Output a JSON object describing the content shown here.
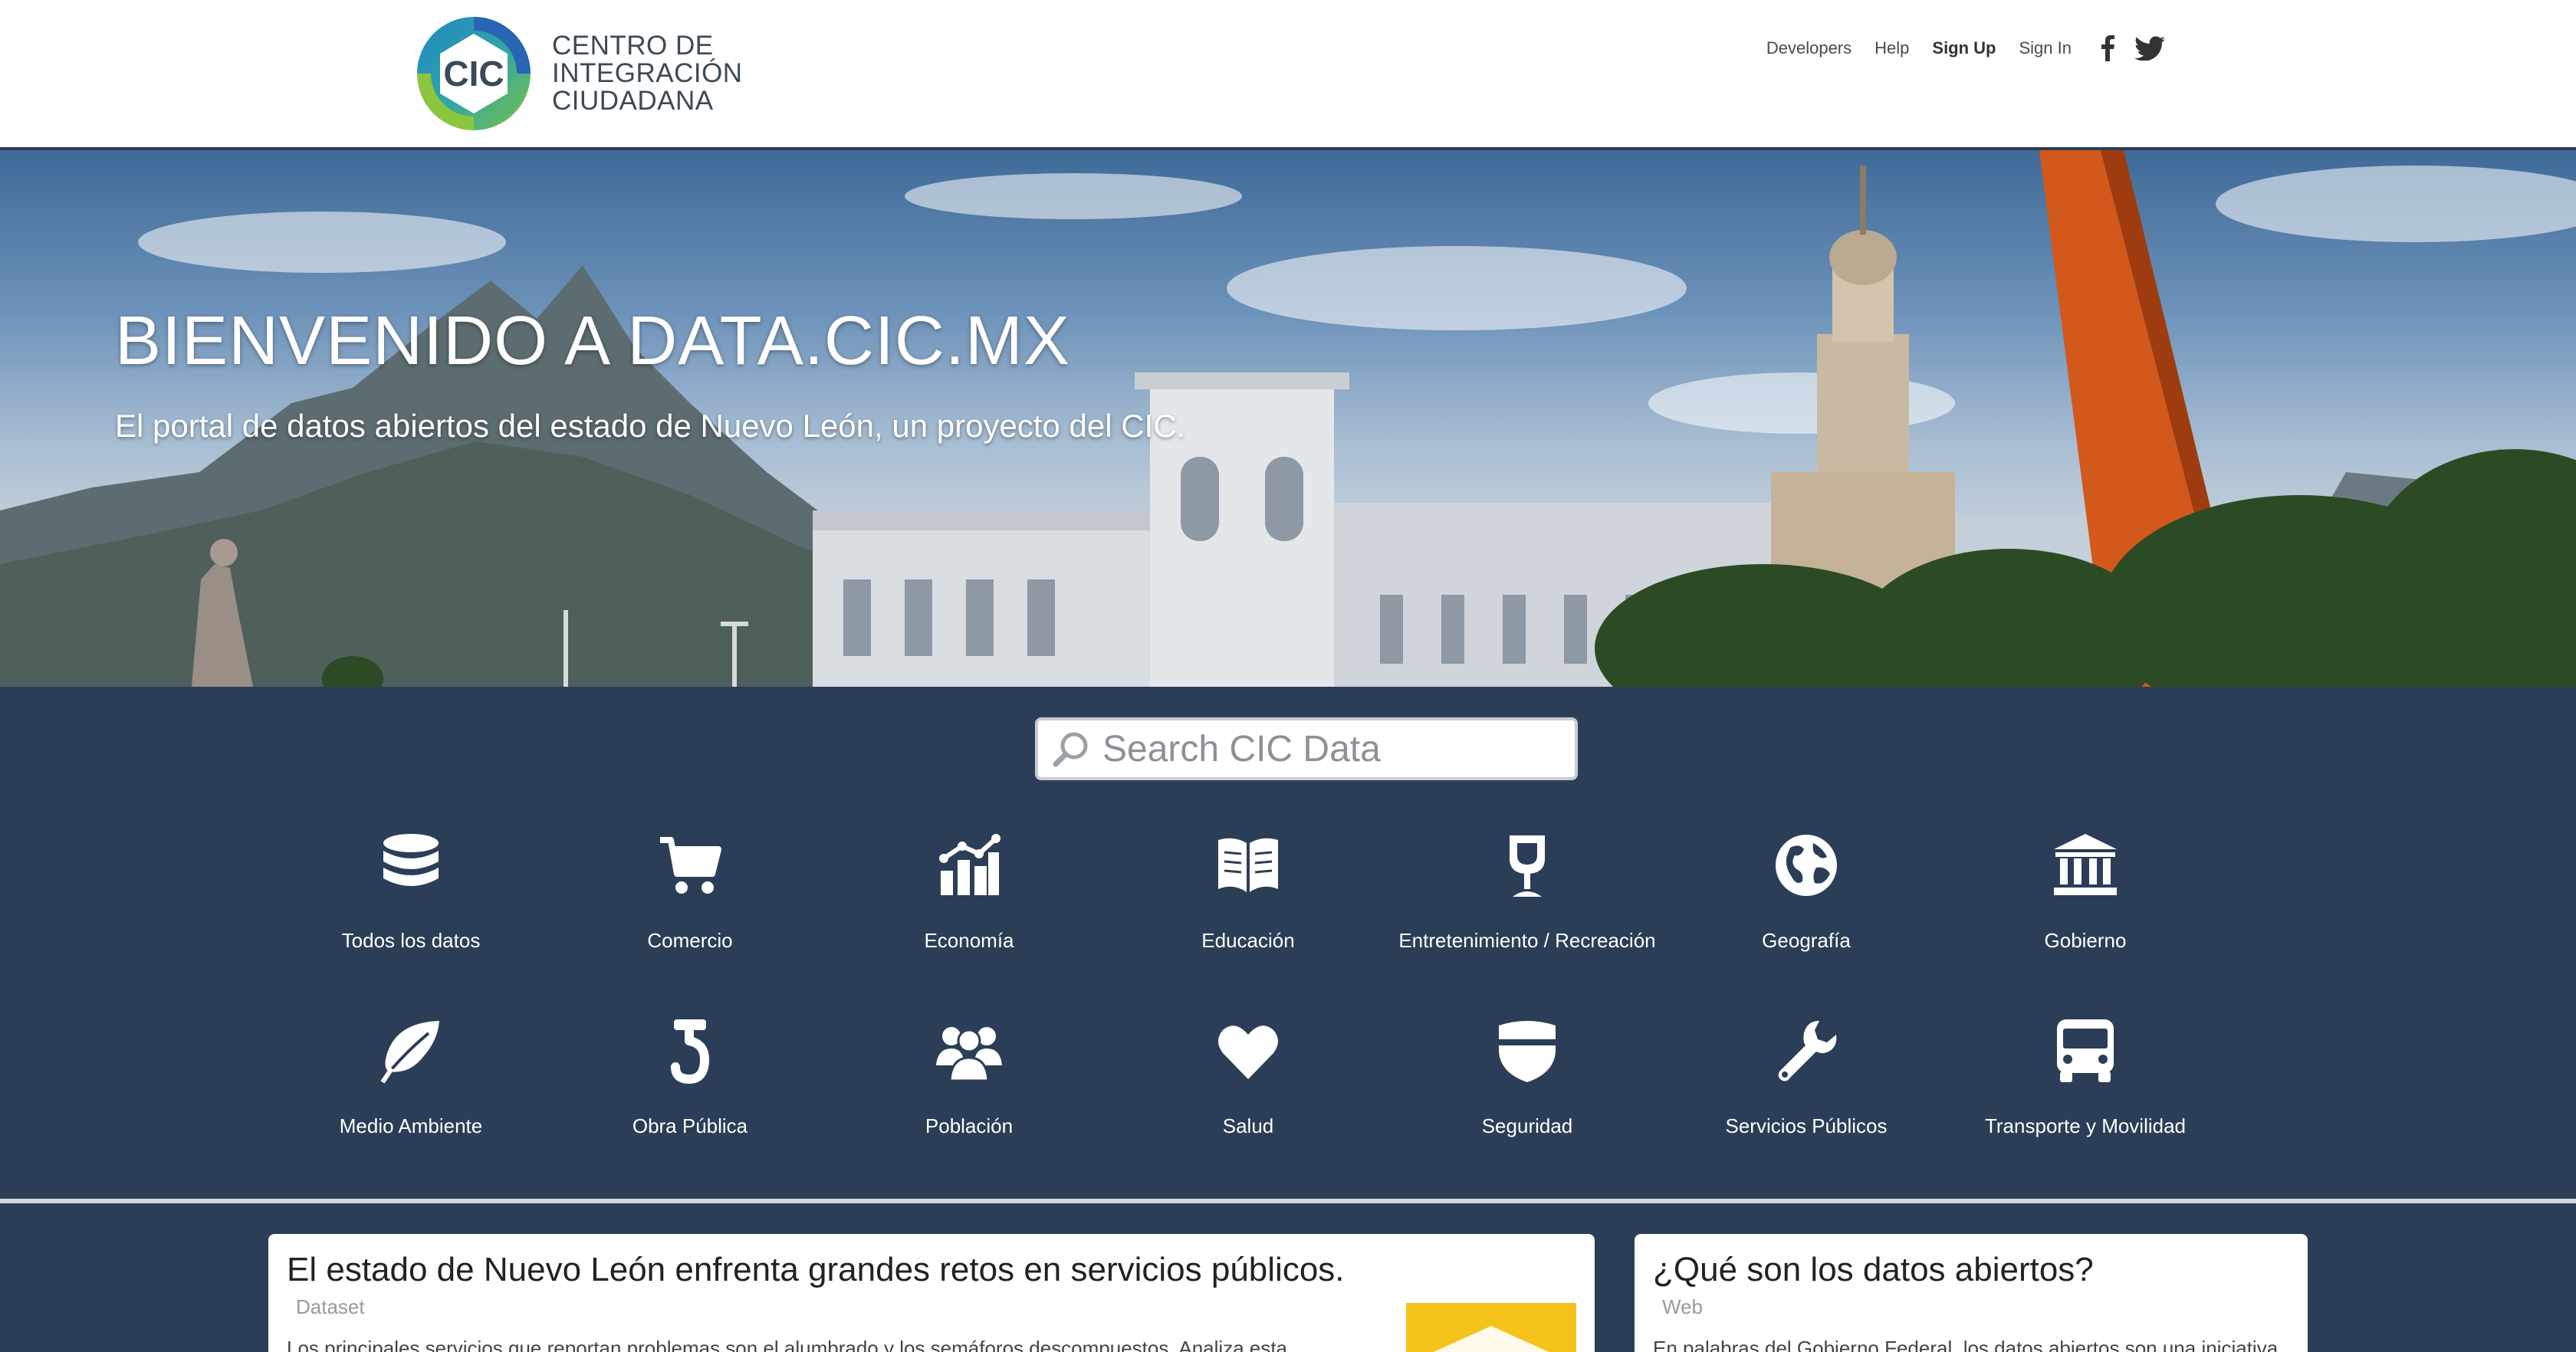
{
  "header": {
    "logo": {
      "acronym": "CIC",
      "line1": "CENTRO DE",
      "line2": "INTEGRACIÓN",
      "line3": "CIUDADANA"
    },
    "nav": {
      "developers": "Developers",
      "help": "Help",
      "signup": "Sign Up",
      "signin": "Sign In"
    },
    "social": [
      "facebook-icon",
      "twitter-icon"
    ]
  },
  "hero": {
    "title": "BIENVENIDO A DATA.CIC.MX",
    "subtitle": "El portal de datos abiertos del estado de Nuevo León, un proyecto del CIC."
  },
  "search": {
    "placeholder": "Search CIC Data"
  },
  "categories": [
    {
      "label": "Todos los datos",
      "icon": "database-icon"
    },
    {
      "label": "Comercio",
      "icon": "shopping-cart-icon"
    },
    {
      "label": "Economía",
      "icon": "growth-chart-icon"
    },
    {
      "label": "Educación",
      "icon": "book-icon"
    },
    {
      "label": "Entretenimiento / Recreación",
      "icon": "wine-glass-icon"
    },
    {
      "label": "Geografía",
      "icon": "globe-icon"
    },
    {
      "label": "Gobierno",
      "icon": "government-building-icon"
    },
    {
      "label": "Medio Ambiente",
      "icon": "leaf-icon"
    },
    {
      "label": "Obra Pública",
      "icon": "crane-hook-icon"
    },
    {
      "label": "Población",
      "icon": "people-icon"
    },
    {
      "label": "Salud",
      "icon": "heart-icon"
    },
    {
      "label": "Seguridad",
      "icon": "shield-icon"
    },
    {
      "label": "Servicios Públicos",
      "icon": "wrench-icon"
    },
    {
      "label": "Transporte y Movilidad",
      "icon": "bus-icon"
    }
  ],
  "cards": [
    {
      "title": "El estado de Nuevo León enfrenta grandes retos en servicios públicos.",
      "type": "Dataset",
      "excerpt": "Los principales servicios que reportan problemas son el alumbrado y los semáforos descompuestos. Analiza esta"
    },
    {
      "title": "¿Qué son los datos abiertos?",
      "type": "Web",
      "excerpt": "En palabras del Gobierno Federal, los datos abiertos son una iniciativa"
    }
  ],
  "colors": {
    "panel": "#2c3e57",
    "accent": "#f4c21b"
  }
}
